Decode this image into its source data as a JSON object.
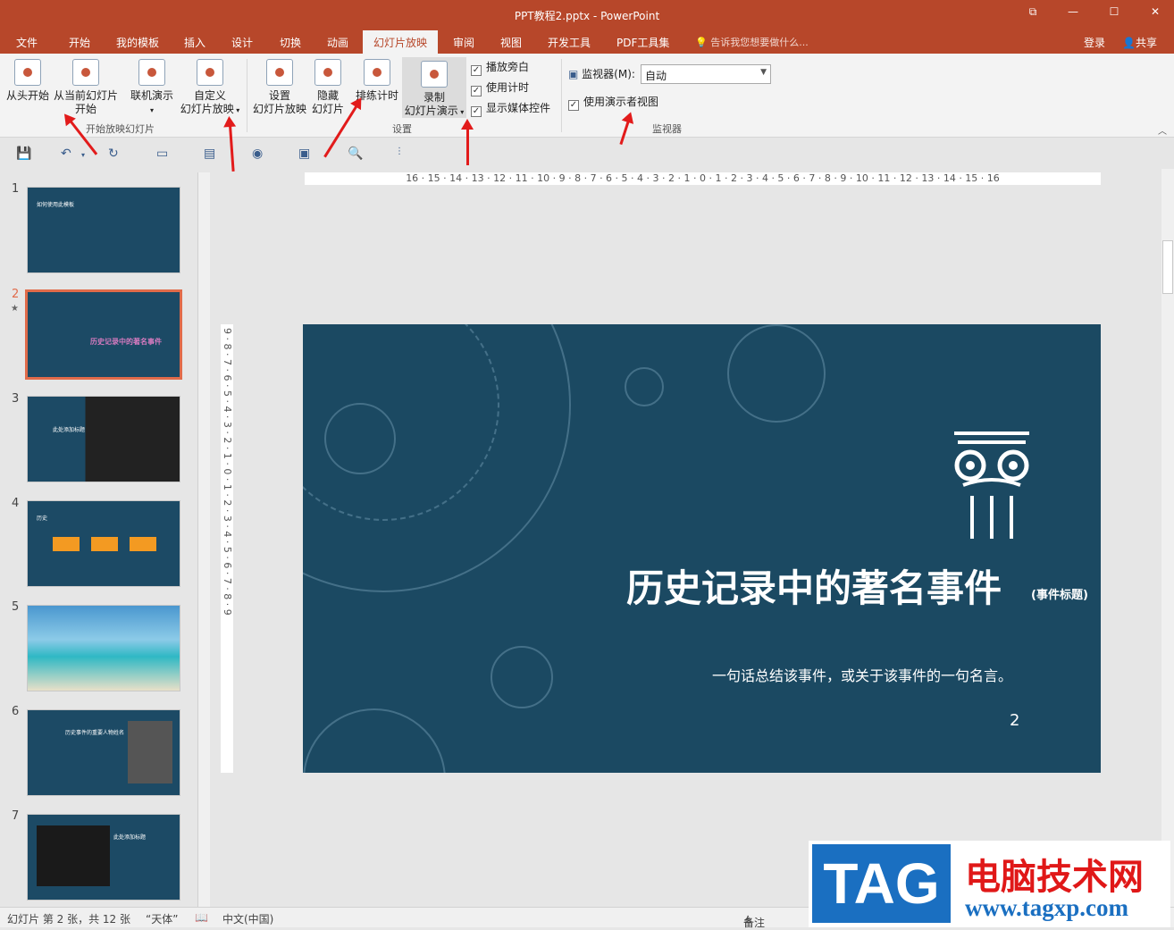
{
  "window": {
    "title": "PPT教程2.pptx - PowerPoint"
  },
  "tabs": [
    "文件",
    "开始",
    "我的模板",
    "插入",
    "设计",
    "切换",
    "动画",
    "幻灯片放映",
    "审阅",
    "视图",
    "开发工具",
    "PDF工具集"
  ],
  "active_tab": "幻灯片放映",
  "tell_me": "告诉我您想要做什么...",
  "account": {
    "login": "登录",
    "share": "共享"
  },
  "ribbon": {
    "start_group": {
      "label": "开始放映幻灯片",
      "from_start": "从头开始",
      "from_current_1": "从当前幻灯片",
      "from_current_2": "开始",
      "online_1": "联机演示",
      "custom_1": "自定义",
      "custom_2": "幻灯片放映"
    },
    "setup_group": {
      "label": "设置",
      "setup_1": "设置",
      "setup_2": "幻灯片放映",
      "hide_1": "隐藏",
      "hide_2": "幻灯片",
      "rehearse": "排练计时",
      "record_1": "录制",
      "record_2": "幻灯片演示"
    },
    "checks": [
      {
        "label": "播放旁白",
        "checked": true
      },
      {
        "label": "使用计时",
        "checked": true
      },
      {
        "label": "显示媒体控件",
        "checked": true
      }
    ],
    "monitor_group": {
      "label": "监视器",
      "monitor_label": "监视器(M):",
      "monitor_value": "自动",
      "presenter_view": "使用演示者视图"
    }
  },
  "ruler": {
    "horizontal": "16 · 15 · 14 · 13 · 12 · 11 · 10 · 9 · 8 · 7 · 6 · 5 · 4 · 3 · 2 · 1 · 0 · 1 · 2 · 3 · 4 · 5 · 6 · 7 · 8 · 9 · 10 · 11 · 12 · 13 · 14 · 15 · 16",
    "vertical": "9 · 8 · 7 · 6 · 5 · 4 · 3 · 2 · 1 · 0 · 1 · 2 · 3 · 4 · 5 · 6 · 7 · 8 · 9"
  },
  "thumbnails": [
    {
      "num": "1",
      "text": "如何使用此模板"
    },
    {
      "num": "2",
      "text": "历史记录中的著名事件",
      "selected": true
    },
    {
      "num": "3",
      "text": "此处添加标题"
    },
    {
      "num": "4",
      "text": "历史"
    },
    {
      "num": "5",
      "text": ""
    },
    {
      "num": "6",
      "text": "历史事件的重要人物姓名"
    },
    {
      "num": "7",
      "text": "此处添加标题"
    }
  ],
  "slide": {
    "title": "历史记录中的著名事件",
    "tag": "(事件标题)",
    "subtitle": "一句话总结该事件，或关于该事件的一句名言。",
    "number": "2"
  },
  "status": {
    "slide_info": "幻灯片 第 2 张，共 12 张",
    "theme": "“天体”",
    "language": "中文(中国)",
    "notes": "备注"
  },
  "watermark": {
    "tag": "TAG",
    "cn": "电脑技术网",
    "url": "www.tagxp.com"
  }
}
